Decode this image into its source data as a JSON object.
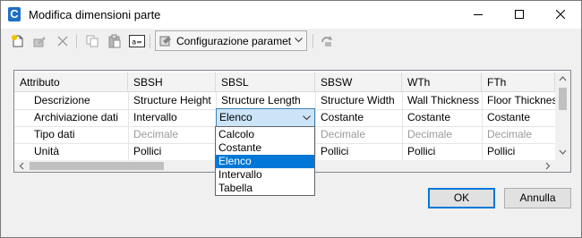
{
  "window": {
    "title": "Modifica dimensioni parte",
    "app_icon_letter": "C"
  },
  "toolbar": {
    "icons": [
      "new-icon",
      "edit-icon",
      "delete-icon",
      "copy-icon",
      "paste-icon",
      "rename-parameter-icon",
      "settings-icon",
      "refresh-icon"
    ],
    "config_label": "Configurazione paramet"
  },
  "grid": {
    "headers": [
      "Attributo",
      "SBSH",
      "SBSL",
      "SBSW",
      "WTh",
      "FTh"
    ],
    "rows": [
      {
        "label": "Descrizione",
        "cells": [
          "Structure Height",
          "Structure Length",
          "Structure Width",
          "Wall Thickness",
          "Floor Thicknes"
        ]
      },
      {
        "label": "Archiviazione dati",
        "cells": [
          "Intervallo",
          "Elenco",
          "Costante",
          "Costante",
          "Costante"
        ]
      },
      {
        "label": "Tipo dati",
        "cells": [
          "Decimale",
          "",
          "Decimale",
          "Decimale",
          "Decimale"
        ]
      },
      {
        "label": "Unità",
        "cells": [
          "Pollici",
          "",
          "Pollici",
          "Pollici",
          "Pollici"
        ]
      }
    ]
  },
  "dropdown": {
    "options": [
      "Calcolo",
      "Costante",
      "Elenco",
      "Intervallo",
      "Tabella"
    ],
    "selected": "Elenco"
  },
  "buttons": {
    "ok": "OK",
    "cancel": "Annulla"
  },
  "colors": {
    "selection": "#0078d7",
    "edit_cell": "#cce4f7"
  }
}
